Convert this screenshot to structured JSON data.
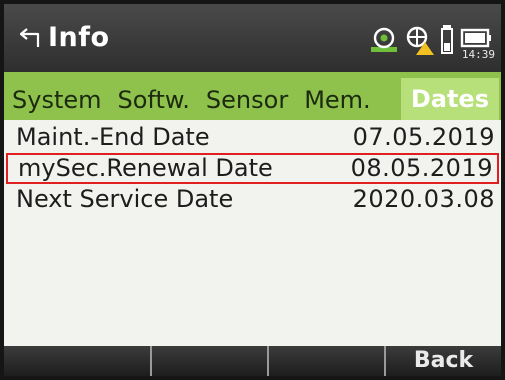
{
  "header": {
    "title": "Info",
    "clock": "14:39",
    "icons": [
      "back-arrow-icon",
      "globe-status-icon",
      "warning-target-icon",
      "battery-tube-icon",
      "memory-card-icon"
    ]
  },
  "tabs": [
    {
      "label": "System"
    },
    {
      "label": "Softw."
    },
    {
      "label": "Sensor"
    },
    {
      "label": "Mem."
    },
    {
      "label": "Dates",
      "active": true
    }
  ],
  "rows": [
    {
      "label": "Maint.-End Date",
      "value": "07.05.2019"
    },
    {
      "label": "mySec.Renewal Date",
      "value": "08.05.2019",
      "selected": true
    },
    {
      "label": "Next Service Date",
      "value": "2020.03.08"
    }
  ],
  "softkeys": [
    "",
    "",
    "",
    "Back"
  ],
  "colors": {
    "tab_bar": "#8ec24c",
    "active_tab": "#b7e07a",
    "selection_border": "#e02020",
    "titlebar": "#3a3a3a"
  }
}
